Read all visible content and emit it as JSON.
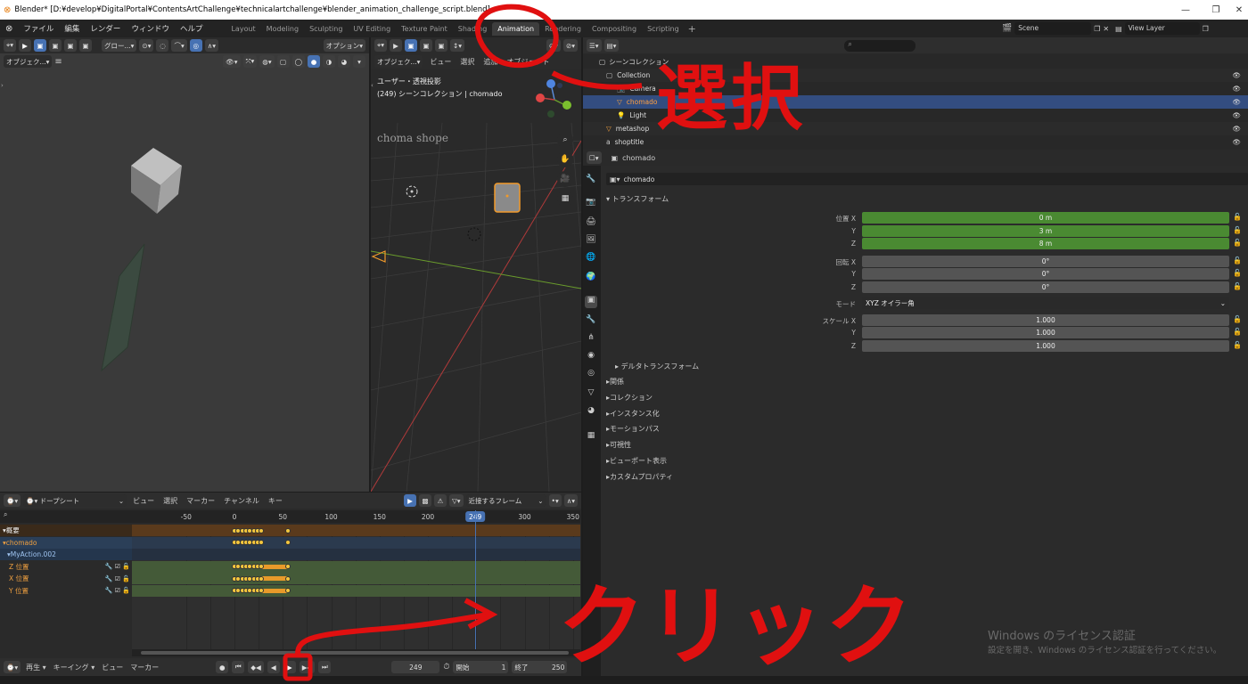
{
  "window": {
    "title": "Blender* [D:¥develop¥DigitalPortal¥ContentsArtChallenge¥technicalartchallenge¥blender_animation_challenge_script.blend]"
  },
  "menus": [
    "ファイル",
    "編集",
    "レンダー",
    "ウィンドウ",
    "ヘルプ"
  ],
  "workspaces": [
    "Layout",
    "Modeling",
    "Sculpting",
    "UV Editing",
    "Texture Paint",
    "Shading",
    "Animation",
    "Rendering",
    "Compositing",
    "Scripting"
  ],
  "active_workspace": "Animation",
  "scene": {
    "name": "Scene",
    "view_layer": "View Layer"
  },
  "left_viewport": {
    "mode": "オブジェク...",
    "transform": "グロー...",
    "options": "オプション"
  },
  "main_viewport": {
    "mode": "オブジェク...",
    "menus": [
      "ビュー",
      "選択",
      "追加",
      "オブジェクト"
    ],
    "info_line1": "ユーザー・透視投影",
    "info_line2": "(249) シーンコレクション | chomado",
    "text_object": "choma shope"
  },
  "outliner": {
    "root": "シーンコレクション",
    "items": [
      {
        "name": "Collection",
        "indent": 1
      },
      {
        "name": "Camera",
        "indent": 2
      },
      {
        "name": "chomado",
        "indent": 2,
        "selected": true
      },
      {
        "name": "Light",
        "indent": 2
      },
      {
        "name": "metashop",
        "indent": 1
      },
      {
        "name": "shoptitle",
        "indent": 1
      }
    ]
  },
  "properties": {
    "object_name": "chomado",
    "object_field": "chomado",
    "transform_panel": "トランスフォーム",
    "location": {
      "label": "位置 X",
      "x": "0 m",
      "y": "3 m",
      "z": "8 m"
    },
    "rotation": {
      "label": "回転 X",
      "x": "0°",
      "y": "0°",
      "z": "0°"
    },
    "mode_label": "モード",
    "mode_value": "XYZ オイラー角",
    "scale": {
      "label": "スケール X",
      "x": "1.000",
      "y": "1.000",
      "z": "1.000"
    },
    "axis_y": "Y",
    "axis_z": "Z",
    "delta": "デルタトランスフォーム",
    "panels": [
      "関係",
      "コレクション",
      "インスタンス化",
      "モーションパス",
      "可視性",
      "ビューポート表示",
      "カスタムプロパティ"
    ]
  },
  "dopesheet": {
    "editor": "ドープシート",
    "menus": [
      "ビュー",
      "選択",
      "マーカー",
      "チャンネル",
      "キー"
    ],
    "snap": "近接するフレーム",
    "ruler": [
      "-50",
      "0",
      "50",
      "100",
      "150",
      "200",
      "249",
      "300",
      "350"
    ],
    "current_frame": "249",
    "channels": [
      {
        "name": "概要",
        "type": "summary"
      },
      {
        "name": "chomado",
        "type": "object"
      },
      {
        "name": "MyAction.002",
        "type": "action"
      },
      {
        "name": "Z 位置",
        "type": "fcurve"
      },
      {
        "name": "X 位置",
        "type": "fcurve"
      },
      {
        "name": "Y 位置",
        "type": "fcurve"
      }
    ]
  },
  "timeline": {
    "menus": [
      "再生",
      "キーイング",
      "ビュー",
      "マーカー"
    ],
    "current": "249",
    "start_label": "開始",
    "start": "1",
    "end_label": "終了",
    "end": "250"
  },
  "watermark": {
    "line1": "Windows のライセンス認証",
    "line2": "設定を開き、Windows のライセンス認証を行ってください。"
  },
  "annotations": {
    "select": "選択",
    "click": "クリック"
  },
  "colors": {
    "accent": "#4772b3",
    "green_field": "#4a8a32",
    "keyframe": "#f4c63d",
    "annotation": "#e01010"
  }
}
